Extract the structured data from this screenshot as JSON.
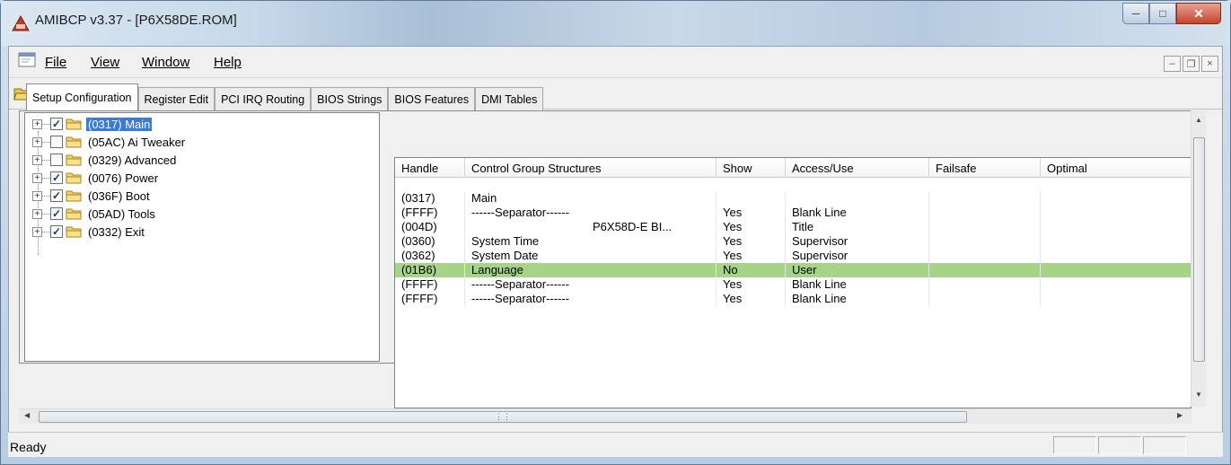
{
  "window": {
    "title": "AMIBCP v3.37 - [P6X58DE.ROM]",
    "icon": "amibcp-triangle-icon"
  },
  "menu": {
    "items": [
      "File",
      "View",
      "Window",
      "Help"
    ]
  },
  "toolbar": {
    "icons": [
      "open-folder-icon",
      "save-disk-icon",
      "help-key-icon"
    ]
  },
  "tabs": [
    {
      "label": "Setup Configuration",
      "active": true
    },
    {
      "label": "Register Edit",
      "active": false
    },
    {
      "label": "PCI IRQ Routing",
      "active": false
    },
    {
      "label": "BIOS Strings",
      "active": false
    },
    {
      "label": "BIOS Features",
      "active": false
    },
    {
      "label": "DMI Tables",
      "active": false
    }
  ],
  "tree": {
    "items": [
      {
        "label": "(0317) Main",
        "checked": true,
        "selected": true
      },
      {
        "label": "(05AC) Ai Tweaker",
        "checked": false,
        "selected": false
      },
      {
        "label": "(0329) Advanced",
        "checked": false,
        "selected": false
      },
      {
        "label": "(0076) Power",
        "checked": true,
        "selected": false
      },
      {
        "label": "(036F) Boot",
        "checked": true,
        "selected": false
      },
      {
        "label": "(05AD) Tools",
        "checked": true,
        "selected": false
      },
      {
        "label": "(0332) Exit",
        "checked": true,
        "selected": false
      }
    ]
  },
  "grid": {
    "columns": [
      "Handle",
      "Control Group Structures",
      "Show",
      "Access/Use",
      "Failsafe",
      "Optimal"
    ],
    "rows": [
      {
        "handle": "(0317)",
        "control": "Main",
        "show": "",
        "access": "",
        "failsafe": "",
        "optimal": "",
        "highlight": false
      },
      {
        "handle": "(FFFF)",
        "control": "------Separator------",
        "show": "Yes",
        "access": "Blank Line",
        "failsafe": "",
        "optimal": "",
        "highlight": false
      },
      {
        "handle": "(004D)",
        "control": "P6X58D-E BI...",
        "show": "Yes",
        "access": "Title",
        "failsafe": "",
        "optimal": "",
        "highlight": false,
        "indent": true
      },
      {
        "handle": "(0360)",
        "control": "System Time",
        "show": "Yes",
        "access": "Supervisor",
        "failsafe": "",
        "optimal": "",
        "highlight": false
      },
      {
        "handle": "(0362)",
        "control": "System Date",
        "show": "Yes",
        "access": "Supervisor",
        "failsafe": "",
        "optimal": "",
        "highlight": false
      },
      {
        "handle": "(01B6)",
        "control": "Language",
        "show": "No",
        "access": "User",
        "failsafe": "",
        "optimal": "",
        "highlight": true
      },
      {
        "handle": "(FFFF)",
        "control": "------Separator------",
        "show": "Yes",
        "access": "Blank Line",
        "failsafe": "",
        "optimal": "",
        "highlight": false
      },
      {
        "handle": "(FFFF)",
        "control": "------Separator------",
        "show": "Yes",
        "access": "Blank Line",
        "failsafe": "",
        "optimal": "",
        "highlight": false
      }
    ]
  },
  "status": {
    "text": "Ready"
  },
  "colors": {
    "highlight_row": "#a6d486",
    "selection": "#3a7bd5"
  }
}
